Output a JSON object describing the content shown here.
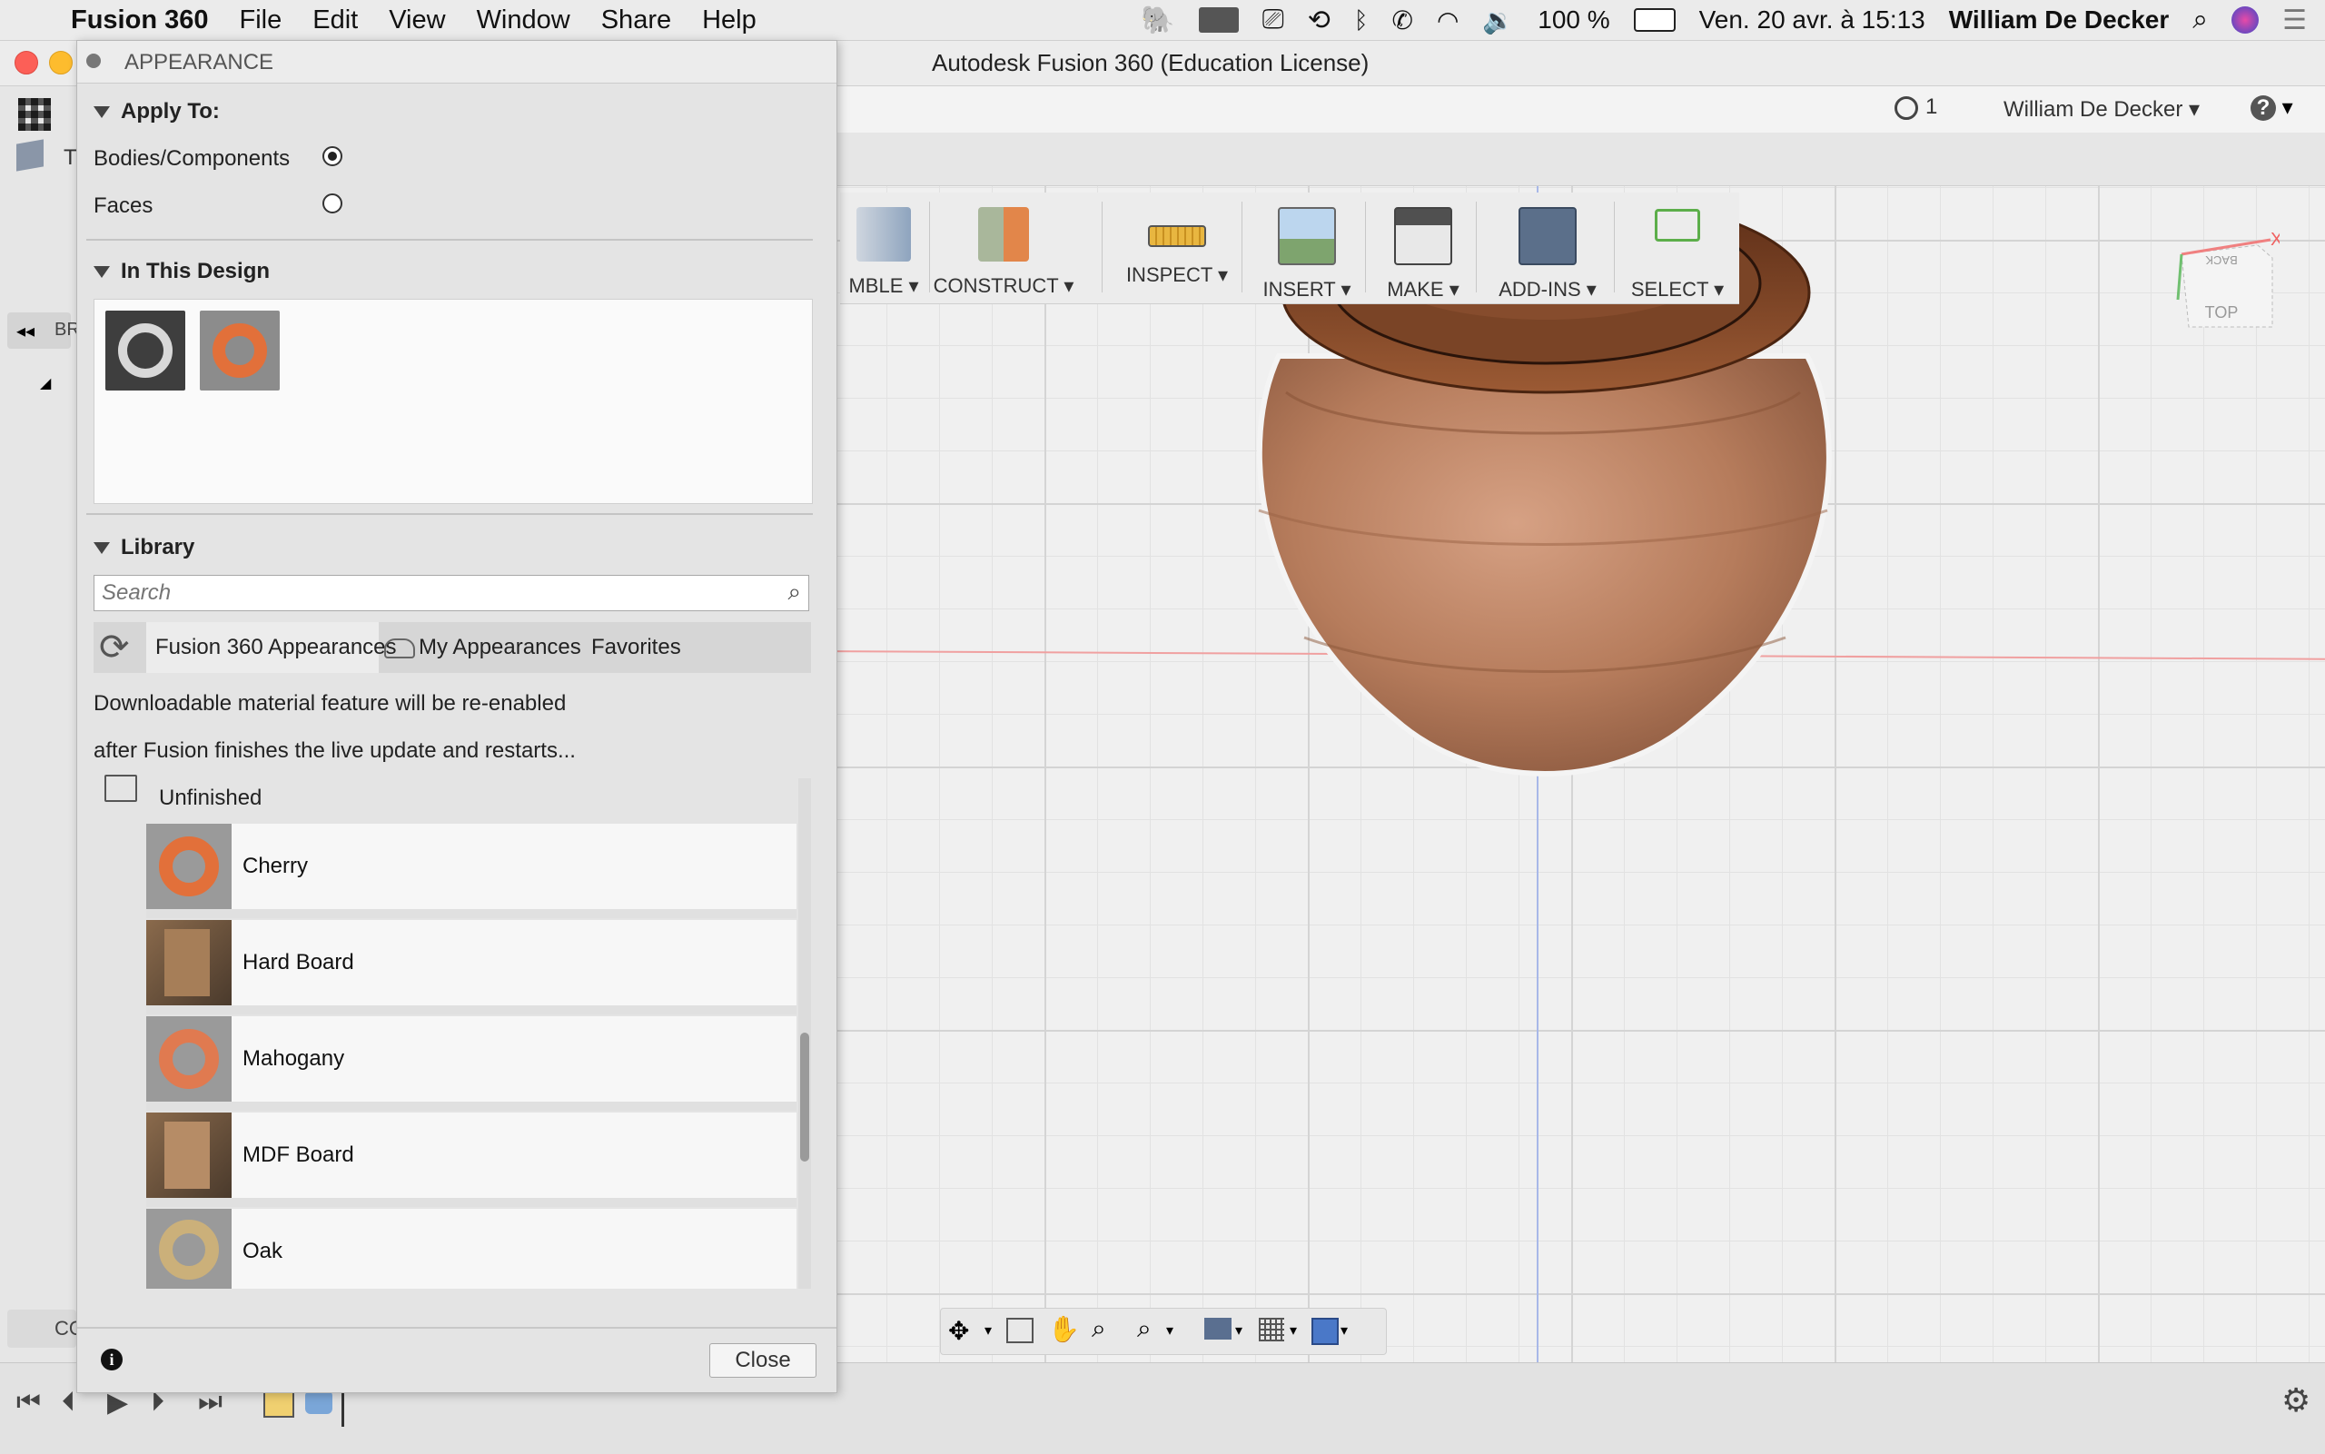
{
  "menubar": {
    "app_name": "Fusion 360",
    "items": [
      "File",
      "Edit",
      "View",
      "Window",
      "Share",
      "Help"
    ],
    "battery": "100 %",
    "clock": "Ven. 20 avr. à 15:13",
    "user": "William De Decker"
  },
  "window": {
    "title": "Autodesk Fusion 360 (Education License)"
  },
  "header": {
    "job_count": "1",
    "user": "William De Decker"
  },
  "toolbar": {
    "items": [
      "MBLE",
      "CONSTRUCT",
      "INSPECT",
      "INSERT",
      "MAKE",
      "ADD-INS",
      "SELECT"
    ]
  },
  "viewcube": {
    "top_label": "TOP",
    "back_label": "BACK",
    "x_label": "X"
  },
  "appearance_panel": {
    "title": "APPEARANCE",
    "apply_to": {
      "heading": "Apply To:",
      "options": [
        {
          "label": "Bodies/Components",
          "selected": true
        },
        {
          "label": "Faces",
          "selected": false
        }
      ]
    },
    "in_this_design": {
      "heading": "In This Design"
    },
    "library": {
      "heading": "Library",
      "search_placeholder": "Search",
      "tabs": [
        "Fusion 360 Appearances",
        "My Appearances",
        "Favorites"
      ],
      "notice_line1": "Downloadable material feature will be re-enabled",
      "notice_line2": "after Fusion finishes the live update and restarts...",
      "folder": "Unfinished",
      "materials": [
        "Cherry",
        "Hard Board",
        "Mahogany",
        "MDF Board",
        "Oak"
      ]
    },
    "close_label": "Close",
    "info_icon_text": "i"
  },
  "left_browser": {
    "partial_label_1": "T",
    "partial_label_2": "BR",
    "partial_label_3": "CO"
  },
  "colors": {
    "wood": "#b97a58",
    "orange_swatch": "#e2703a",
    "panel_bg": "#e4e4e4"
  }
}
